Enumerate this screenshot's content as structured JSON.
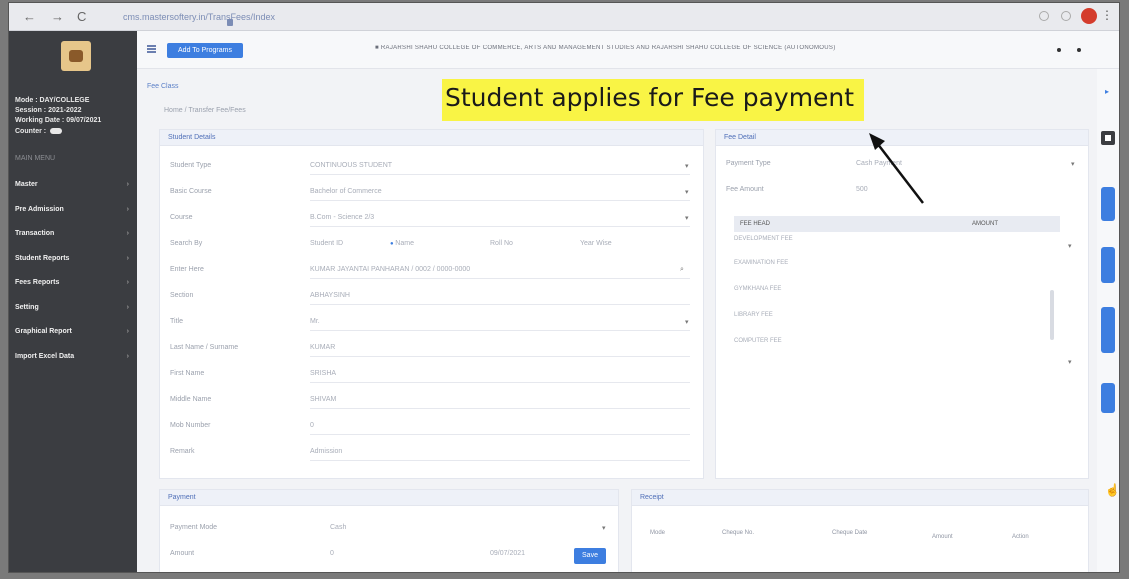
{
  "browser": {
    "back": "←",
    "forward": "→",
    "reload": "C",
    "url": "cms.mastersoftery.in/TransFees/Index"
  },
  "sidebar": {
    "info": [
      "Mode : DAY/COLLEGE",
      "Session : 2021-2022",
      "Working Date : 09/07/2021"
    ],
    "counter_label": "Counter :",
    "menu_header": "MAIN MENU",
    "items": [
      {
        "label": "Master"
      },
      {
        "label": "Pre Admission"
      },
      {
        "label": "Transaction"
      },
      {
        "label": "Student Reports"
      },
      {
        "label": "Fees Reports"
      },
      {
        "label": "Setting"
      },
      {
        "label": "Graphical Report"
      },
      {
        "label": "Import Excel Data"
      }
    ]
  },
  "topbar": {
    "button_label": "Add To Programs",
    "college": "■ RAJARSHI SHAHU COLLEGE OF COMMERCE, ARTS AND MANAGEMENT STUDIES AND RAJARSHI SHAHU COLLEGE OF SCIENCE (AUTONOMOUS)"
  },
  "page": {
    "title": "Fee Class",
    "breadcrumb": "Home / Transfer Fee/Fees"
  },
  "student_details": {
    "header": "Student Details",
    "fields": [
      {
        "label": "Student Type",
        "value": "CONTINUOUS STUDENT",
        "caret": true
      },
      {
        "label": "Basic Course",
        "value": "Bachelor of Commerce",
        "caret": true
      },
      {
        "label": "Course",
        "value": "B.Com - Science 2/3",
        "caret": true
      },
      {
        "label": "Search By",
        "value": "",
        "caret": false
      },
      {
        "label": "Enter Here",
        "value": "KUMAR JAYANTAI PANHARAN / 0002 / 0000-0000",
        "caret": true
      },
      {
        "label": "Section",
        "value": "ABHAYSINH",
        "caret": false
      },
      {
        "label": "Title",
        "value": "Mr.",
        "caret": true
      },
      {
        "label": "Last Name / Surname",
        "value": "KUMAR",
        "caret": false
      },
      {
        "label": "First Name",
        "value": "SRISHA",
        "caret": false
      },
      {
        "label": "Middle Name",
        "value": "SHIVAM",
        "caret": false
      },
      {
        "label": "Mob Number",
        "value": "0",
        "caret": false
      },
      {
        "label": "Remark",
        "value": "Admission",
        "caret": false
      }
    ],
    "search_options": [
      "Student ID",
      "Name",
      "Roll No",
      "Year Wise"
    ],
    "search_selected": "Name"
  },
  "fee_details": {
    "header": "Fee Detail",
    "payment_type_label": "Payment Type",
    "payment_type_value": "Cash Payment",
    "fee_amount_label": "Fee Amount",
    "fee_amount_value": "500",
    "table_headers": [
      "FEE HEAD",
      "AMOUNT"
    ],
    "items": [
      "DEVELOPMENT FEE",
      "EXAMINATION FEE",
      "GYMKHANA FEE",
      "LIBRARY FEE",
      "COMPUTER FEE"
    ]
  },
  "payment": {
    "header": "Payment",
    "mode_label": "Payment Mode",
    "mode_value": "Cash",
    "amount_label": "Amount",
    "amount_value": "0",
    "date_value": "09/07/2021",
    "save_label": "Save"
  },
  "receipt": {
    "header": "Receipt",
    "columns": [
      "Mode",
      "Cheque No.",
      "Cheque Date",
      "Amount",
      "Action"
    ]
  },
  "annotation": {
    "text": "Student applies for Fee payment",
    "bg": "#f9f445"
  },
  "colors": {
    "accent": "#3d7ee0",
    "sidebar": "#3b3d41"
  }
}
